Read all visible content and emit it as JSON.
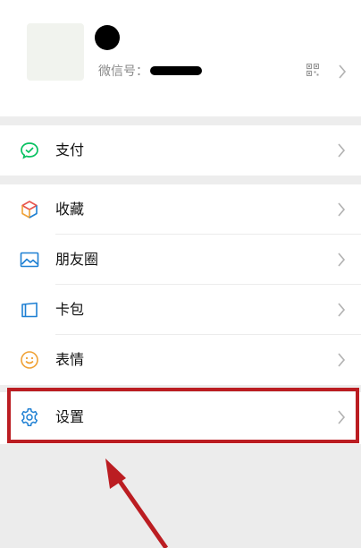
{
  "profile": {
    "wxid_label": "微信号：",
    "qr_icon": "qr-code-icon"
  },
  "menu": {
    "pay": {
      "label": "支付",
      "icon": "wechat-pay-icon",
      "color": "#07c160"
    },
    "favorites": {
      "label": "收藏",
      "icon": "cube-icon"
    },
    "moments": {
      "label": "朋友圈",
      "icon": "image-icon",
      "color": "#1f80d3"
    },
    "cards": {
      "label": "卡包",
      "icon": "card-icon",
      "color": "#1f80d3"
    },
    "stickers": {
      "label": "表情",
      "icon": "smiley-icon",
      "color": "#f0a236"
    },
    "settings": {
      "label": "设置",
      "icon": "gear-icon",
      "color": "#1f80d3"
    }
  },
  "annotation": {
    "color": "#bb1d22"
  }
}
